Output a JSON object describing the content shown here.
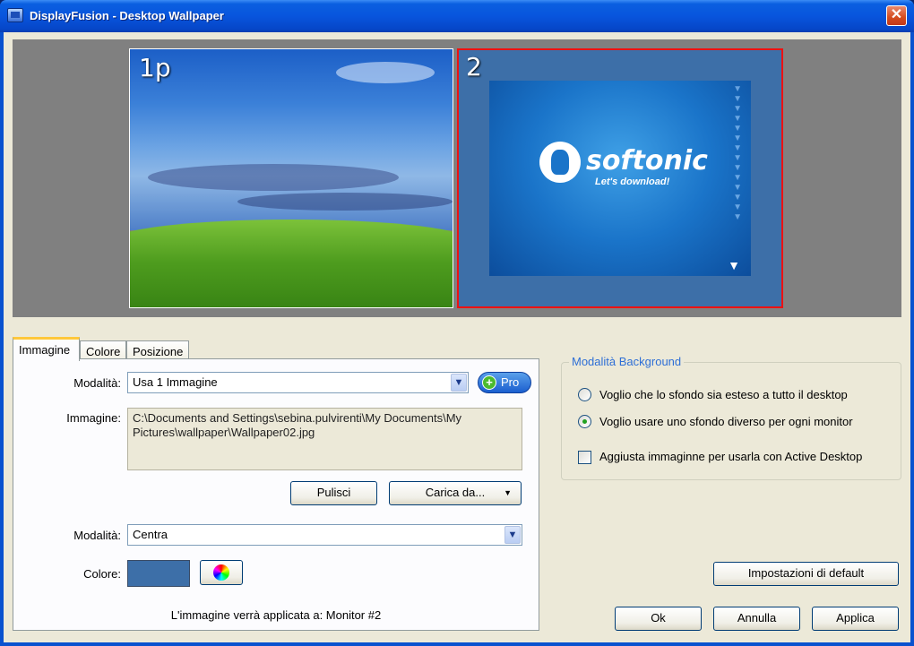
{
  "window": {
    "title": "DisplayFusion - Desktop Wallpaper",
    "close_label": "✕"
  },
  "preview": {
    "monitor1": {
      "label": "1p"
    },
    "monitor2": {
      "label": "2",
      "logo_text": "softonic",
      "logo_tagline": "Let's download!"
    }
  },
  "tabs": [
    {
      "label": "Immagine"
    },
    {
      "label": "Colore"
    },
    {
      "label": "Posizione"
    }
  ],
  "image_tab": {
    "mode_label": "Modalità:",
    "mode_value": "Usa 1 Immagine",
    "pro_label": "Pro",
    "image_label": "Immagine:",
    "image_path": "C:\\Documents and Settings\\sebina.pulvirenti\\My Documents\\My Pictures\\wallpaper\\Wallpaper02.jpg",
    "clear_button": "Pulisci",
    "load_button": "Carica da...",
    "position_mode_label": "Modalità:",
    "position_mode_value": "Centra",
    "color_label": "Colore:",
    "color_value": "#3d6fa8",
    "applied_text": "L'immagine verrà applicata a: Monitor #2"
  },
  "background_mode": {
    "title": "Modalità Background",
    "option_span": "Voglio che lo sfondo sia esteso a tutto il desktop",
    "option_per_monitor": "Voglio usare uno sfondo diverso per ogni monitor",
    "selected": "per_monitor",
    "active_desktop_label": "Aggiusta immaginne per usarla con Active Desktop",
    "active_desktop_checked": false
  },
  "buttons": {
    "defaults": "Impostazioni di default",
    "ok": "Ok",
    "cancel": "Annulla",
    "apply": "Applica"
  },
  "icons": [
    "app-icon",
    "close-icon",
    "dropdown-arrow-icon",
    "pro-plus-icon",
    "color-wheel-icon"
  ]
}
